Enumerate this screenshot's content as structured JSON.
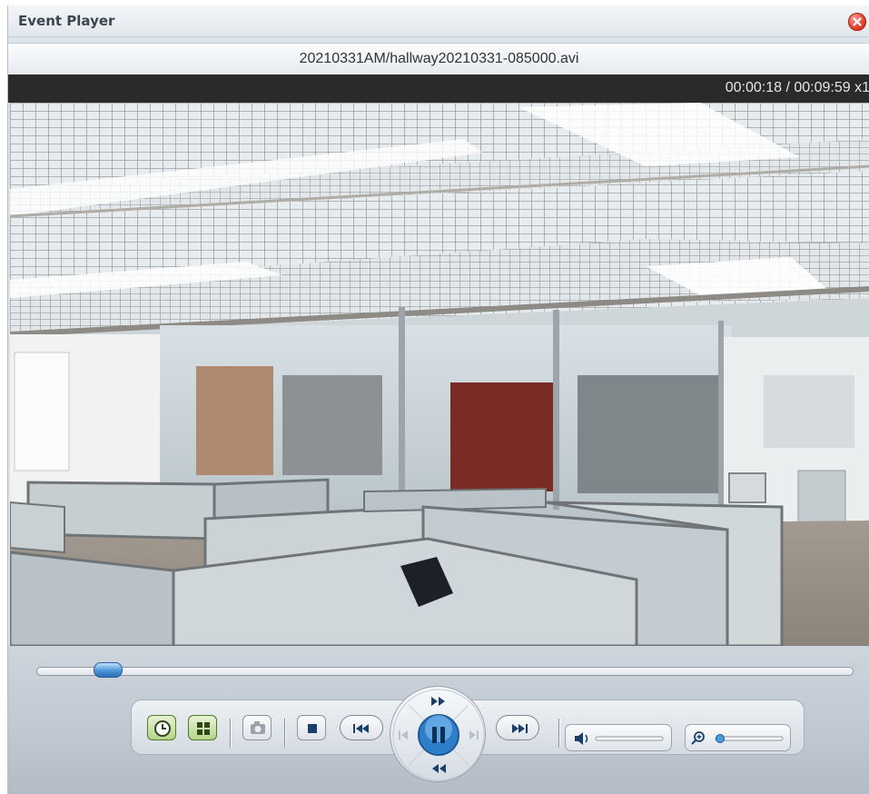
{
  "window": {
    "title": "Event Player",
    "close_icon": "close-icon"
  },
  "file": {
    "name": "20210331AM/hallway20210331-085000.avi"
  },
  "playback": {
    "time": "00:00:18 / 00:00:09:59",
    "time_display": "00:00:18 / 00:09:59  x1",
    "position_fraction": 0.03
  },
  "controls": {
    "icons": [
      "clock-icon",
      "layout-icon",
      "snapshot-icon",
      "stop-icon",
      "previous-icon",
      "pause-icon",
      "fast-forward-icon",
      "rewind-icon",
      "next-icon",
      "volume-icon",
      "zoom-icon"
    ],
    "accent": "#4a9be0",
    "volume_level": 0.0,
    "zoom_level": 0.0
  }
}
